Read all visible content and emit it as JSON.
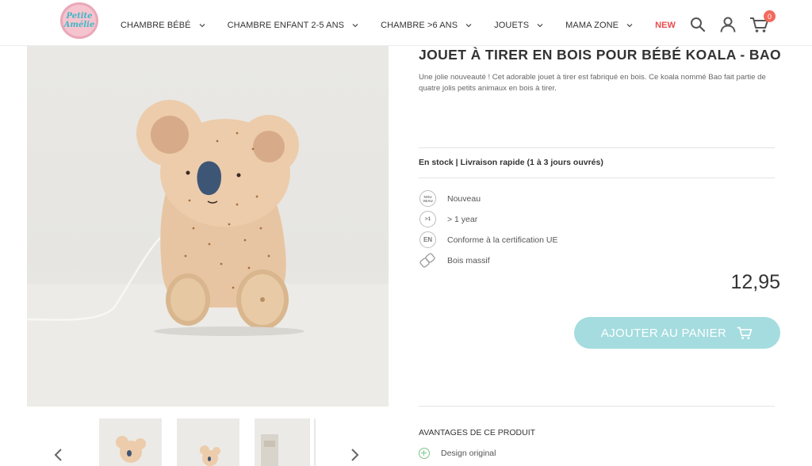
{
  "brand": {
    "logo_line1": "Petite",
    "logo_line2": "Amélie"
  },
  "nav": {
    "items": [
      {
        "label": "CHAMBRE BÉBÉ"
      },
      {
        "label": "CHAMBRE ENFANT 2-5 ANS"
      },
      {
        "label": "CHAMBRE >6 ANS"
      },
      {
        "label": "JOUETS"
      },
      {
        "label": "MAMA ZONE"
      },
      {
        "label": "NEW"
      }
    ],
    "cart_count": "0",
    "icons": [
      "search-icon",
      "account-icon",
      "cart-icon"
    ]
  },
  "product": {
    "title": "JOUET À TIRER EN BOIS POUR BÉBÉ KOALA - BAO",
    "description": "Une jolie nouveauté ! Cet adorable jouet à tirer est fabriqué en bois. Ce koala nommé Bao fait partie de quatre jolis petits animaux en bois à tirer.",
    "stock": "En stock | Livraison rapide (1 à 3 jours ouvrés)",
    "features": [
      {
        "icon": "nouveau-badge-icon",
        "icon_text": "NOU VEAU",
        "label": "Nouveau"
      },
      {
        "icon": "age-badge-icon",
        "icon_text": ">1",
        "label": "> 1 year"
      },
      {
        "icon": "en-certification-icon",
        "icon_text": "EN",
        "label": "Conforme à la certification UE"
      },
      {
        "icon": "wood-icon",
        "icon_text": "",
        "label": "Bois massif"
      }
    ],
    "price": "12,95",
    "add_to_cart_label": "AJOUTER AU PANIER",
    "advantages_title": "AVANTAGES DE CE PRODUIT",
    "advantages": [
      {
        "label": "Design original"
      }
    ]
  },
  "colors": {
    "accent": "#a4dcdf",
    "logo_pink": "#f5c4cf",
    "logo_text": "#3fb7c6",
    "new_red": "#e94b4b",
    "badge": "#f26a5c"
  }
}
